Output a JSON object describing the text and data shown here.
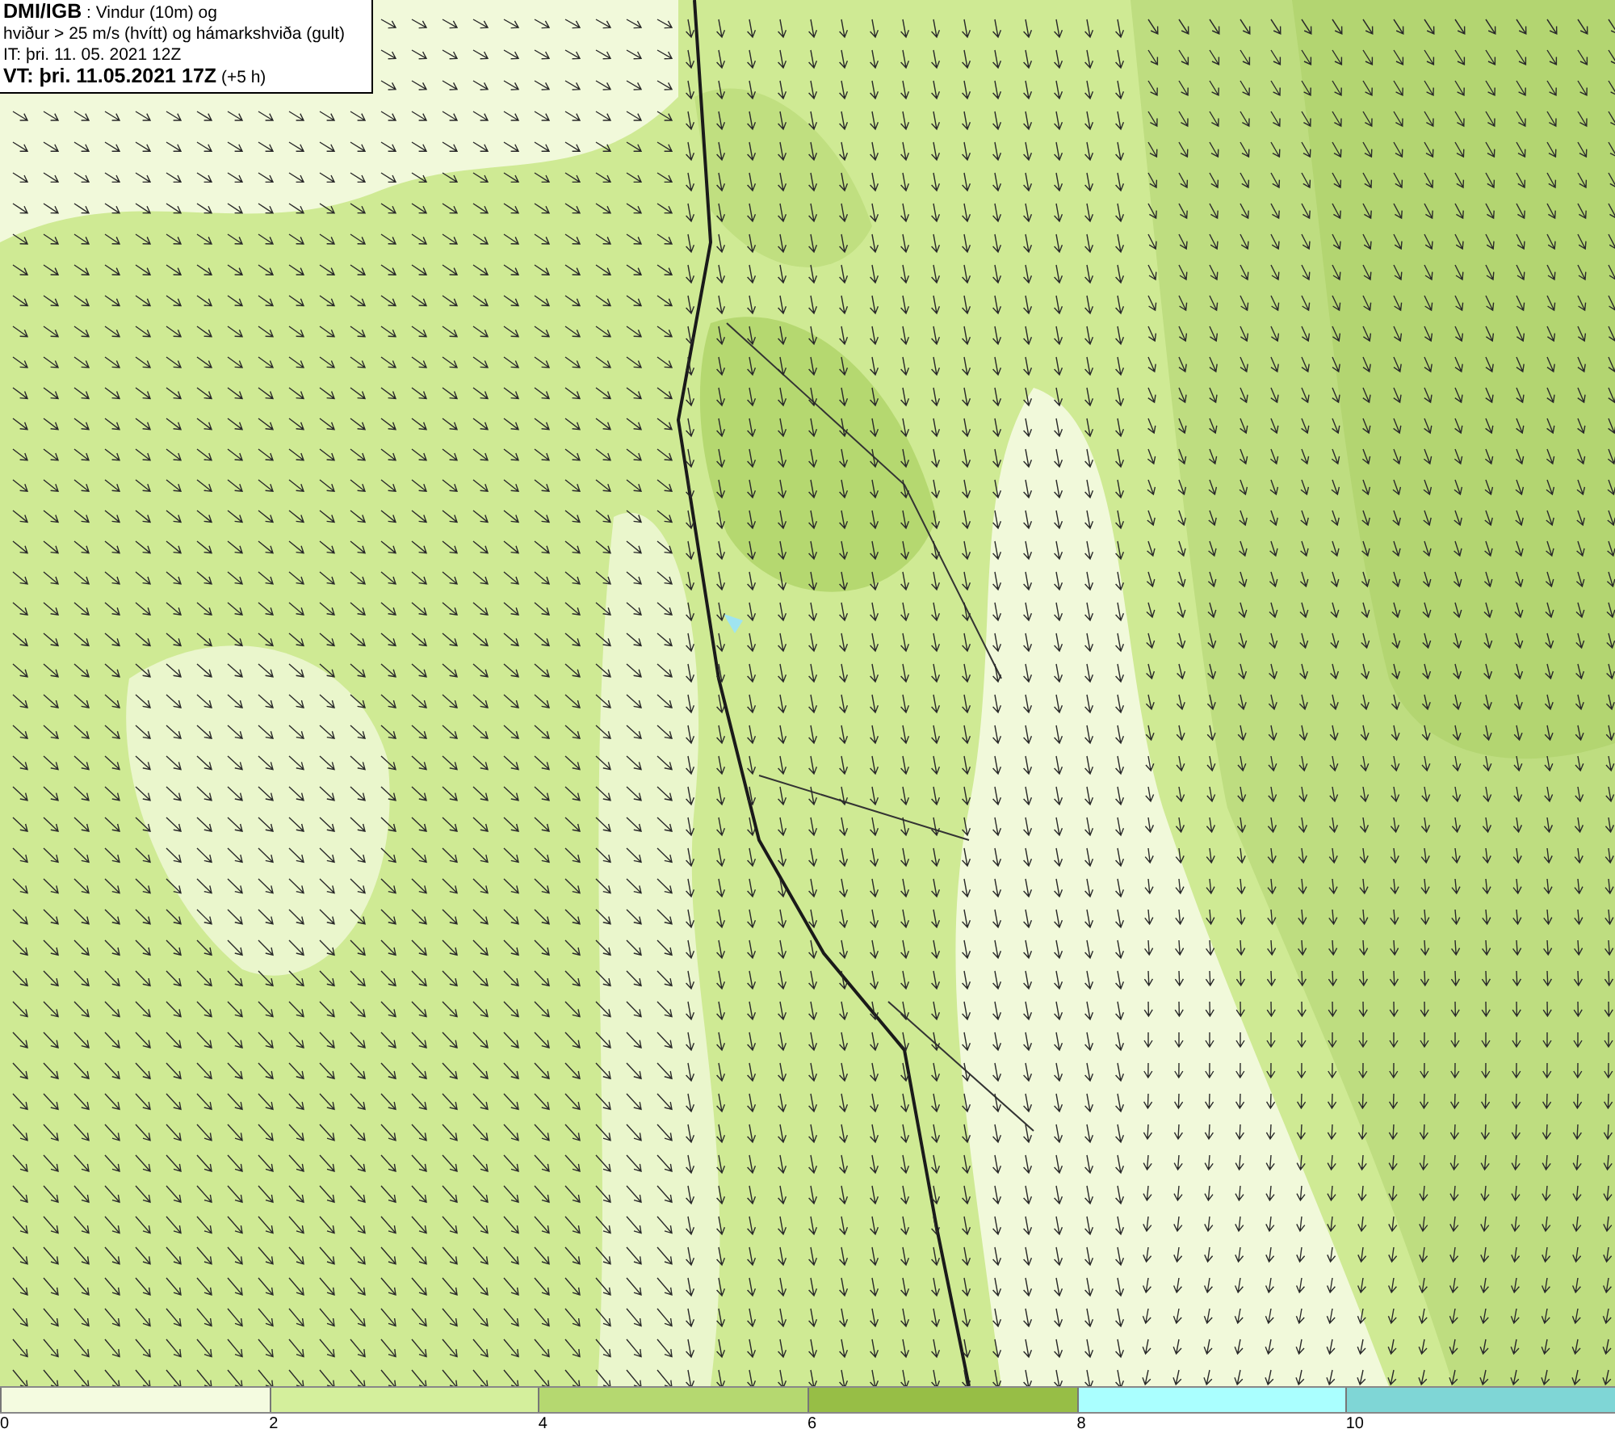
{
  "title_box": {
    "lines": [
      "**DMI/IGB** : Vindur (10m) og",
      "hviður > 25 m/s (hvítt) og hámarkshviða (gult)",
      "IT: þri. 11. 05. 2021 12Z",
      "**VT: þri. 11.05.2021 17Z** (+5 h)"
    ]
  },
  "legend": {
    "bins": [
      {
        "label": "0",
        "color": "#f4fbe0"
      },
      {
        "label": "2",
        "color": "#d4ef9c"
      },
      {
        "label": "4",
        "color": "#b5d870"
      },
      {
        "label": "6",
        "color": "#97be46"
      },
      {
        "label": "8",
        "color": "#aaffff"
      },
      {
        "label": "10",
        "color": "#7fd6d6"
      }
    ]
  }
}
